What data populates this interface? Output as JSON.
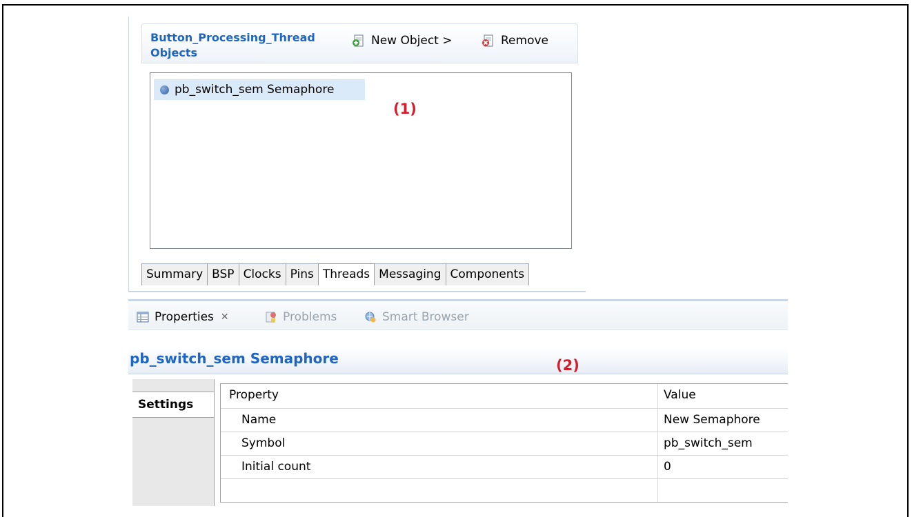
{
  "objects_panel": {
    "title": "Button_Processing_Thread Objects",
    "new_object_label": "New Object >",
    "remove_label": "Remove",
    "items": [
      {
        "label": "pb_switch_sem Semaphore"
      }
    ],
    "marker": "(1)",
    "tabs": [
      "Summary",
      "BSP",
      "Clocks",
      "Pins",
      "Threads",
      "Messaging",
      "Components"
    ],
    "active_tab": "Threads"
  },
  "properties_panel": {
    "tabs": [
      {
        "label": "Properties",
        "icon": "properties-icon"
      },
      {
        "label": "Problems",
        "icon": "problems-icon"
      },
      {
        "label": "Smart Browser",
        "icon": "smart-browser-icon"
      }
    ],
    "title": "pb_switch_sem Semaphore",
    "marker": "(2)",
    "side_tab": "Settings",
    "table": {
      "headers": [
        "Property",
        "Value"
      ],
      "rows": [
        [
          "Name",
          "New Semaphore"
        ],
        [
          "Symbol",
          "pb_switch_sem"
        ],
        [
          "Initial count",
          "0"
        ]
      ]
    }
  }
}
